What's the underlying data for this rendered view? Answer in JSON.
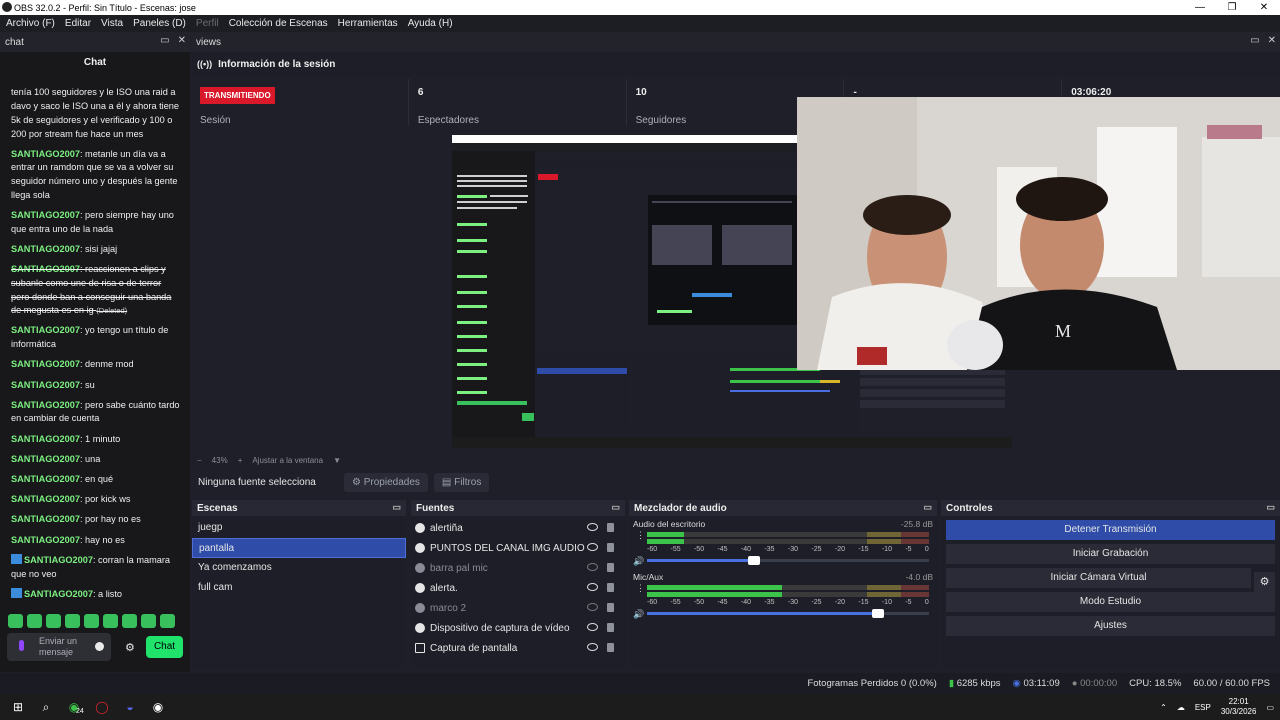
{
  "window": {
    "title": "OBS 32.0.2 - Perfil: Sin Título - Escenas: jose",
    "min": "—",
    "max": "❐",
    "close": "✕"
  },
  "menu": [
    {
      "label": "Archivo (F)",
      "disabled": false
    },
    {
      "label": "Editar",
      "disabled": false
    },
    {
      "label": "Vista",
      "disabled": false
    },
    {
      "label": "Paneles (D)",
      "disabled": false
    },
    {
      "label": "Perfil",
      "disabled": true
    },
    {
      "label": "Colección de Escenas",
      "disabled": false
    },
    {
      "label": "Herramientas",
      "disabled": false
    },
    {
      "label": "Ayuda (H)",
      "disabled": false
    }
  ],
  "chat": {
    "dock_title": "chat",
    "header": "Chat",
    "messages": [
      {
        "user": "",
        "text": "tenía 100 seguidores y le ISO una raid a davo y saco le ISO una a él y ahora tiene 5k de seguidores y el verificado y 100 o 200 por stream fue hace un mes",
        "deleted": false,
        "badge": false
      },
      {
        "user": "SANTIAGO2007",
        "text": ": metanle un día va a entrar un ramdom que se va a volver su seguidor número uno y después la gente llega sola",
        "deleted": false,
        "badge": false
      },
      {
        "user": "SANTIAGO2007",
        "text": ": pero siempre hay uno que entra uno de la nada",
        "deleted": false,
        "badge": false
      },
      {
        "user": "SANTIAGO2007",
        "text": ": sisi jajaj",
        "deleted": false,
        "badge": false
      },
      {
        "user": "SANTIAGO2007",
        "text": ": reaccionen a clips y subanle como une de risa o de terror pero donde ban a conseguir una banda de megusta es en ig",
        "deleted": true,
        "badge": false
      },
      {
        "user": "SANTIAGO2007",
        "text": ": yo tengo un título de informática",
        "deleted": false,
        "badge": false
      },
      {
        "user": "SANTIAGO2007",
        "text": ": denme mod",
        "deleted": false,
        "badge": false
      },
      {
        "user": "SANTIAGO2007",
        "text": ": su",
        "deleted": false,
        "badge": false
      },
      {
        "user": "SANTIAGO2007",
        "text": ": pero sabe cuánto tardo en cambiar de cuenta",
        "deleted": false,
        "badge": false
      },
      {
        "user": "SANTIAGO2007",
        "text": ": 1 minuto",
        "deleted": false,
        "badge": false
      },
      {
        "user": "SANTIAGO2007",
        "text": ": una",
        "deleted": false,
        "badge": false
      },
      {
        "user": "SANTIAGO2007",
        "text": ": en qué",
        "deleted": false,
        "badge": false
      },
      {
        "user": "SANTIAGO2007",
        "text": ": por kick ws",
        "deleted": false,
        "badge": false
      },
      {
        "user": "SANTIAGO2007",
        "text": ": por hay no es",
        "deleted": false,
        "badge": false
      },
      {
        "user": "SANTIAGO2007",
        "text": ": hay no es",
        "deleted": false,
        "badge": false
      },
      {
        "user": "SANTIAGO2007",
        "text": ": corran la mamara que no veo",
        "deleted": false,
        "badge": true
      },
      {
        "user": "SANTIAGO2007",
        "text": ": a listo",
        "deleted": false,
        "badge": true
      }
    ],
    "deleted_label": "(Deleted)",
    "input_placeholder": "Enviar un mensaje",
    "send_label": "Chat"
  },
  "views": {
    "dock_title": "views",
    "session_title": "Información de la sesión",
    "status_badge": "TRANSMITIENDO",
    "stats": [
      {
        "value": "",
        "label": "Sesión"
      },
      {
        "value": "6",
        "label": "Espectadores"
      },
      {
        "value": "10",
        "label": "Seguidores"
      },
      {
        "value": "-",
        "label": ""
      },
      {
        "value": "03:06:20",
        "label": ""
      }
    ],
    "zoom_minus": "−",
    "zoom_value": "43%",
    "zoom_plus": "+",
    "zoom_fit": "Ajustar a la ventana"
  },
  "properties": {
    "source_text": "Ninguna fuente selecciona",
    "props_label": "Propiedades",
    "filters_label": "Filtros"
  },
  "scenes": {
    "title": "Escenas",
    "items": [
      "juegp",
      "pantalla",
      "Ya comenzamos",
      "full cam"
    ],
    "selected": 1
  },
  "sources": {
    "title": "Fuentes",
    "items": [
      {
        "label": "alertiña",
        "hidden": false,
        "icon": "globe-icon"
      },
      {
        "label": "PUNTOS DEL CANAL IMG AUDIO",
        "hidden": false,
        "icon": "globe-icon"
      },
      {
        "label": "barra pal mic",
        "hidden": true,
        "icon": "globe-icon"
      },
      {
        "label": "alerta.",
        "hidden": false,
        "icon": "globe-icon"
      },
      {
        "label": "marco 2",
        "hidden": true,
        "icon": "globe-icon"
      },
      {
        "label": "Dispositivo de captura de vídeo",
        "hidden": false,
        "icon": "camera-icon"
      },
      {
        "label": "Captura de pantalla",
        "hidden": false,
        "icon": "monitor-icon"
      }
    ]
  },
  "mixer": {
    "title": "Mezclador de audio",
    "channels": [
      {
        "name": "Audio del escritorio",
        "db": "-25.8 dB",
        "level": 0.13,
        "volume": 0.38
      },
      {
        "name": "Mic/Aux",
        "db": "-4.0 dB",
        "level": 0.48,
        "volume": 0.82
      }
    ],
    "ticks": [
      "-60",
      "-55",
      "-50",
      "-45",
      "-40",
      "-35",
      "-30",
      "-25",
      "-20",
      "-15",
      "-10",
      "-5",
      "0"
    ]
  },
  "controls": {
    "title": "Controles",
    "buttons": [
      "Detener Transmisión",
      "Iniciar Grabación",
      "Iniciar Cámara Virtual",
      "Modo Estudio",
      "Ajustes"
    ]
  },
  "statusbar": {
    "dropped": "Fotogramas Perdidos 0 (0.0%)",
    "bitrate": "6285 kbps",
    "stream_time": "03:11:09",
    "rec_time": "00:00:00",
    "cpu": "CPU: 18.5%",
    "fps": "60.00 / 60.00 FPS"
  },
  "taskbar": {
    "lang": "ESP",
    "time": "22:01",
    "date": "30/3/2026",
    "whatsapp_badge": "24"
  },
  "colors": {
    "accent": "#2e4ca8",
    "live": "#d9182a",
    "chat_user": "#7cf081",
    "chat_send": "#1fe36b"
  }
}
